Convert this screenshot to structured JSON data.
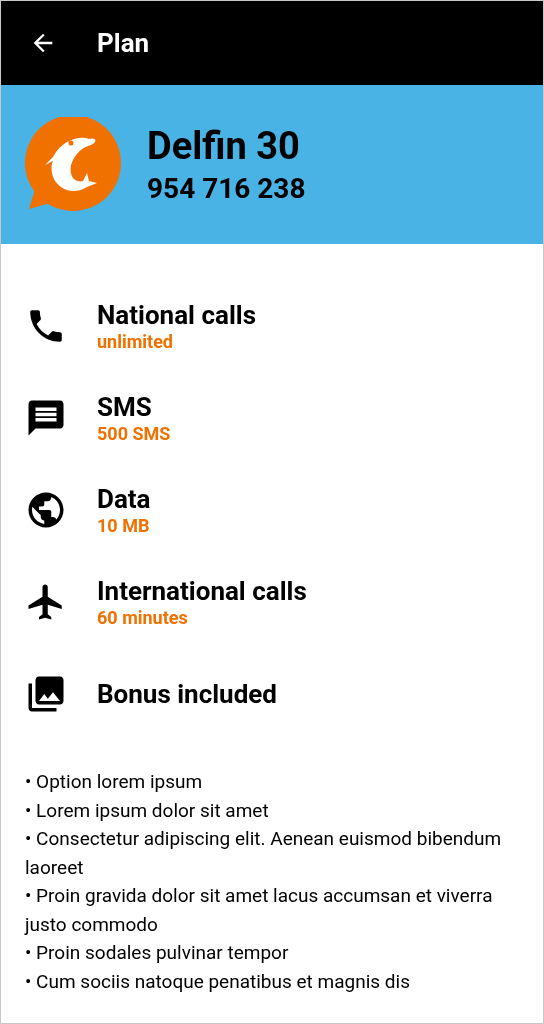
{
  "app_bar": {
    "title": "Plan"
  },
  "plan": {
    "name": "Delfin 30",
    "number": "954 716 238"
  },
  "features": [
    {
      "kind": "phone",
      "title": "National calls",
      "value": "unlimited"
    },
    {
      "kind": "sms",
      "title": "SMS",
      "value": "500 SMS"
    },
    {
      "kind": "data",
      "title": "Data",
      "value": "10 MB"
    },
    {
      "kind": "flight",
      "title": "International calls",
      "value": "60 minutes"
    },
    {
      "kind": "bonus",
      "title": "Bonus included"
    }
  ],
  "bonus_list": [
    "• Option lorem ipsum",
    "• Lorem ipsum dolor sit amet",
    "• Consectetur adipiscing elit. Aenean euismod bibendum laoreet",
    "• Proin gravida dolor sit amet lacus accumsan et viverra justo commodo",
    "• Proin sodales pulvinar tempor",
    "• Cum sociis natoque penatibus et magnis dis"
  ]
}
